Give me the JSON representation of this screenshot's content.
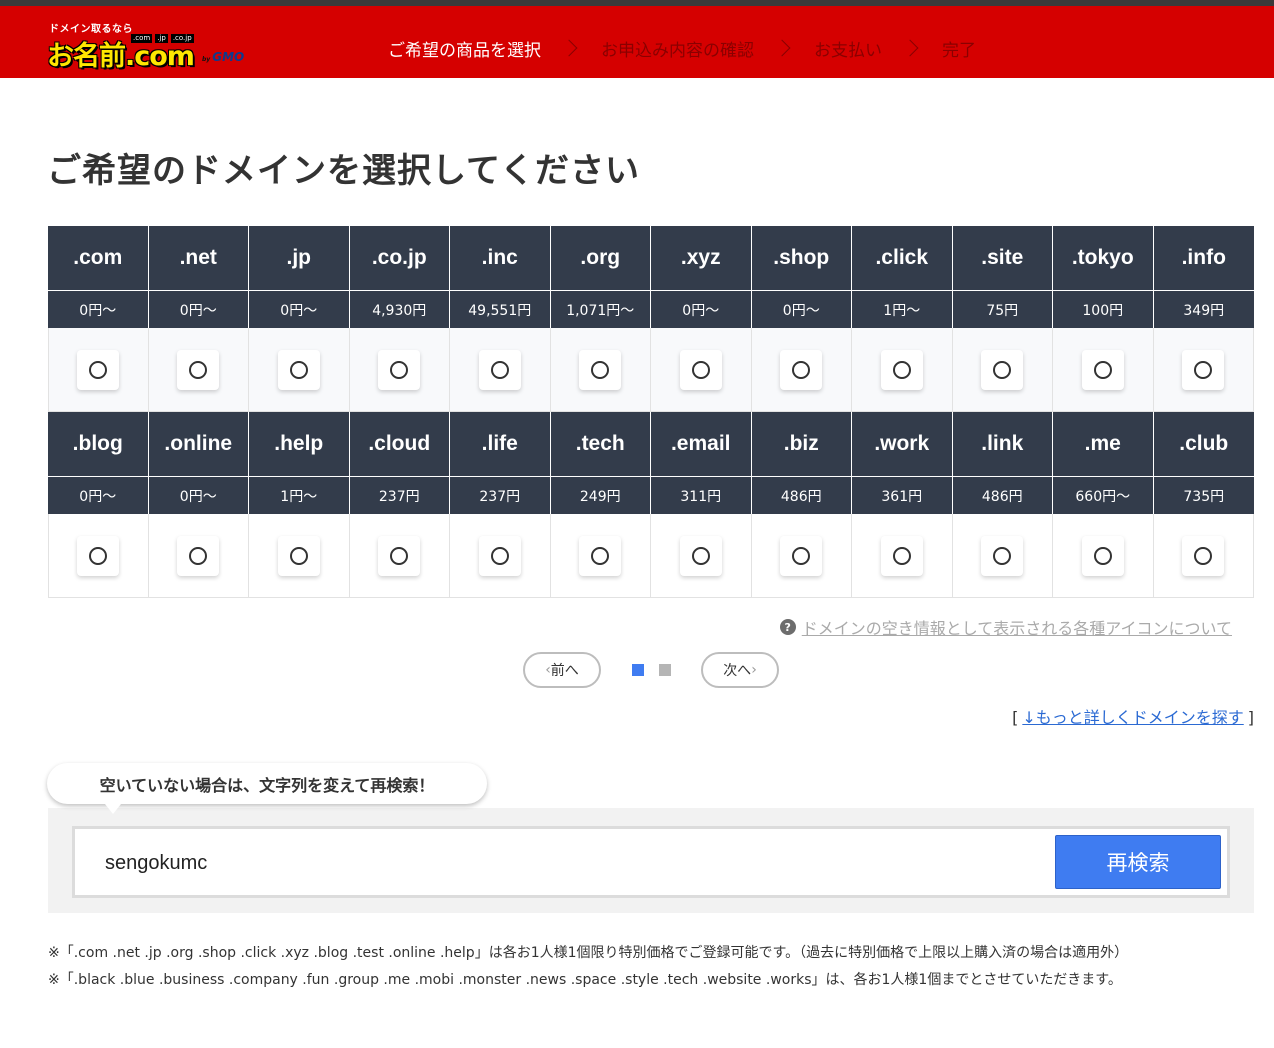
{
  "header": {
    "logo_tagline": "ドメイン取るなら",
    "logo_tlds": [
      ".com",
      ".jp",
      ".co.jp"
    ],
    "logo_main": "お名前.com",
    "logo_by": "by",
    "logo_gmo": "GMO",
    "steps": [
      {
        "label": "ご希望の商品を選択",
        "active": true
      },
      {
        "label": "お申込み内容の確認",
        "active": false
      },
      {
        "label": "お支払い",
        "active": false
      },
      {
        "label": "完了",
        "active": false
      }
    ]
  },
  "page_title": "ご希望のドメインを選択してください",
  "domains_row1": [
    {
      "tld": ".com",
      "price": "0円〜"
    },
    {
      "tld": ".net",
      "price": "0円〜"
    },
    {
      "tld": ".jp",
      "price": "0円〜"
    },
    {
      "tld": ".co.jp",
      "price": "4,930円"
    },
    {
      "tld": ".inc",
      "price": "49,551円"
    },
    {
      "tld": ".org",
      "price": "1,071円〜"
    },
    {
      "tld": ".xyz",
      "price": "0円〜"
    },
    {
      "tld": ".shop",
      "price": "0円〜"
    },
    {
      "tld": ".click",
      "price": "1円〜"
    },
    {
      "tld": ".site",
      "price": "75円"
    },
    {
      "tld": ".tokyo",
      "price": "100円"
    },
    {
      "tld": ".info",
      "price": "349円"
    }
  ],
  "domains_row2": [
    {
      "tld": ".blog",
      "price": "0円〜"
    },
    {
      "tld": ".online",
      "price": "0円〜"
    },
    {
      "tld": ".help",
      "price": "1円〜"
    },
    {
      "tld": ".cloud",
      "price": "237円"
    },
    {
      "tld": ".life",
      "price": "237円"
    },
    {
      "tld": ".tech",
      "price": "249円"
    },
    {
      "tld": ".email",
      "price": "311円"
    },
    {
      "tld": ".biz",
      "price": "486円"
    },
    {
      "tld": ".work",
      "price": "361円"
    },
    {
      "tld": ".link",
      "price": "486円"
    },
    {
      "tld": ".me",
      "price": "660円〜"
    },
    {
      "tld": ".club",
      "price": "735円"
    }
  ],
  "help_link": "ドメインの空き情報として表示される各種アイコンについて",
  "pager": {
    "prev": "前へ",
    "next": "次へ",
    "current_page": 1,
    "total_pages": 2
  },
  "more_search": {
    "bracket_open": "[",
    "link": "↓もっと詳しくドメインを探す",
    "bracket_close": "]"
  },
  "research": {
    "bubble": "空いていない場合は、文字列を変えて再検索！",
    "input_value": "sengokumc",
    "button": "再検索"
  },
  "notes": [
    "※「.com .net .jp .org .shop .click .xyz .blog .test .online .help」は各お1人様1個限り特別価格でご登録可能です。（過去に特別価格で上限以上購入済の場合は適用外）",
    "※「.black .blue .business .company .fun .group .me .mobi .monster .news .space .style .tech .website .works」は、各お1人様1個までとさせていただきます。"
  ],
  "colors": {
    "header_red": "#d50000",
    "table_dark": "#333c4b",
    "accent_blue": "#3f7cf1"
  }
}
